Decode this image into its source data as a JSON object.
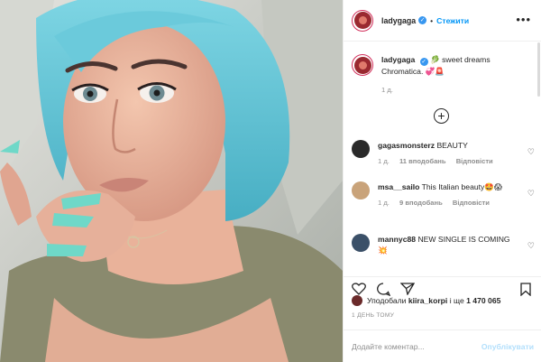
{
  "post": {
    "author": "ladygaga",
    "follow_label": "Стежити",
    "more_label": "•••",
    "verified_mark": "✓"
  },
  "caption": {
    "author": "ladygaga",
    "text": "🥬 sweet dreams Chromatica. 💞🚨",
    "age": "1 д."
  },
  "load_more_label": "+",
  "comments": [
    {
      "author": "gagasmonsterz",
      "text": "BEAUTY",
      "age": "1 д.",
      "likes": "11 вподобань",
      "reply_label": "Відповісти",
      "avatar_color": "#2a2a2a"
    },
    {
      "author": "msa__sailo",
      "text": "This Italian beauty🤩😱",
      "age": "1 д.",
      "likes": "9 вподобань",
      "reply_label": "Відповісти",
      "avatar_color": "#c9a37a"
    },
    {
      "author": "mannyc88",
      "text": "NEW SINGLE IS COMING 💥",
      "age": "",
      "likes": "",
      "reply_label": "",
      "avatar_color": "#3b5068"
    }
  ],
  "likes": {
    "prefix": "Уподобали",
    "liker": "kiira_korpi",
    "middle": "і ще",
    "count": "1 470 065"
  },
  "timestamp": "1 ДЕНЬ ТОМУ",
  "comment_box": {
    "placeholder": "Додайте коментар...",
    "publish_label": "Опублікувати"
  },
  "colors": {
    "accent": "#0095f6",
    "hair": "#5bc3d6",
    "nails": "#6fd8c8"
  }
}
